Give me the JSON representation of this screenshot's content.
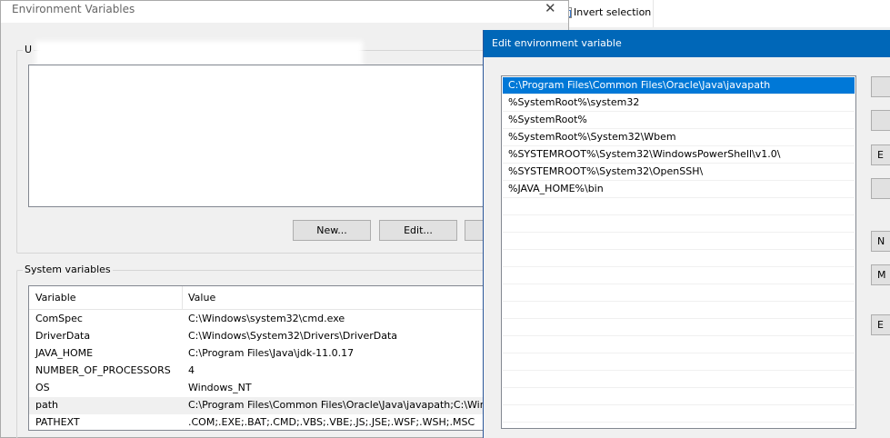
{
  "background": {
    "invert_selection_label": "Invert selection"
  },
  "env_dialog": {
    "title": "Environment Variables",
    "close_glyph": "✕",
    "user_group_label": "U",
    "buttons": {
      "new": "New...",
      "edit": "Edit..."
    },
    "system_group_label": "System variables",
    "system_table": {
      "headers": [
        "Variable",
        "Value"
      ],
      "rows": [
        [
          "ComSpec",
          "C:\\Windows\\system32\\cmd.exe"
        ],
        [
          "DriverData",
          "C:\\Windows\\System32\\Drivers\\DriverData"
        ],
        [
          "JAVA_HOME",
          "C:\\Program Files\\Java\\jdk-11.0.17"
        ],
        [
          "NUMBER_OF_PROCESSORS",
          "4"
        ],
        [
          "OS",
          "Windows_NT"
        ],
        [
          "path",
          "C:\\Program Files\\Common Files\\Oracle\\Java\\javapath;C:\\Win"
        ],
        [
          "PATHEXT",
          ".COM;.EXE;.BAT;.CMD;.VBS;.VBE;.JS;.JSE;.WSF;.WSH;.MSC"
        ]
      ]
    }
  },
  "edit_dialog": {
    "title": "Edit environment variable",
    "entries": [
      "C:\\Program Files\\Common Files\\Oracle\\Java\\javapath",
      "%SystemRoot%\\system32",
      "%SystemRoot%",
      "%SystemRoot%\\System32\\Wbem",
      "%SYSTEMROOT%\\System32\\WindowsPowerShell\\v1.0\\",
      "%SYSTEMROOT%\\System32\\OpenSSH\\",
      "%JAVA_HOME%\\bin"
    ],
    "side_buttons": [
      "",
      "",
      "E",
      "",
      "N",
      "M",
      "E"
    ]
  }
}
